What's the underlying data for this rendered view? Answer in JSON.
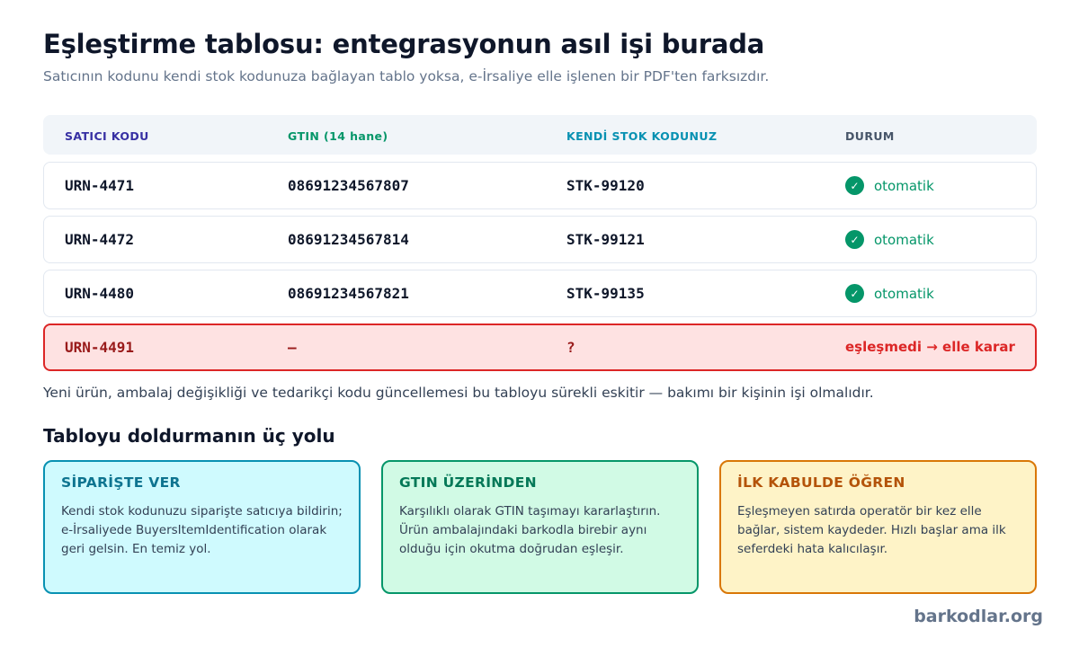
{
  "header": {
    "title": "Eşleştirme tablosu: entegrasyonun asıl işi burada",
    "subtitle": "Satıcının kodunu kendi stok kodunuza bağlayan tablo yoksa, e-İrsaliye elle işlenen bir PDF'ten farksızdır."
  },
  "table": {
    "columns": [
      {
        "label": "SATICI KODU",
        "color": "#3730a3"
      },
      {
        "label": "GTIN (14 hane)",
        "color": "#059669"
      },
      {
        "label": "KENDİ STOK KODUNUZ",
        "color": "#0891b2"
      },
      {
        "label": "DURUM",
        "color": "#475569"
      }
    ],
    "rows": [
      {
        "vendor": "URN-4471",
        "gtin": "08691234567807",
        "stock": "STK-99120",
        "status": "otomatik"
      },
      {
        "vendor": "URN-4472",
        "gtin": "08691234567814",
        "stock": "STK-99121",
        "status": "otomatik"
      },
      {
        "vendor": "URN-4480",
        "gtin": "08691234567821",
        "stock": "STK-99135",
        "status": "otomatik"
      },
      {
        "vendor": "URN-4491",
        "gtin": "—",
        "stock": "?",
        "status": "eşleşmedi → elle karar"
      }
    ],
    "check_glyph": "✓"
  },
  "note": "Yeni ürün, ambalaj değişikliği ve tedarikçi kodu güncellemesi bu tabloyu sürekli eskitir — bakımı bir kişinin işi olmalıdır.",
  "methods": {
    "title": "Tabloyu doldurmanın üç yolu",
    "cards": [
      {
        "title": "SİPARİŞTE VER",
        "body": "Kendi stok kodunuzu siparişte satıcıya bildirin; e-İrsaliyede BuyersItemIdentification olarak geri gelsin. En temiz yol."
      },
      {
        "title": "GTIN ÜZERİNDEN",
        "body": "Karşılıklı olarak GTIN taşımayı kararlaştırın. Ürün ambalajındaki barkodla birebir aynı olduğu için okutma doğrudan eşleşir."
      },
      {
        "title": "İLK KABULDE ÖĞREN",
        "body": "Eşleşmeyen satırda operatör bir kez elle bağlar, sistem kaydeder. Hızlı başlar ama ilk seferdeki hata kalıcılaşır."
      }
    ]
  },
  "brand": "barkodlar.org"
}
